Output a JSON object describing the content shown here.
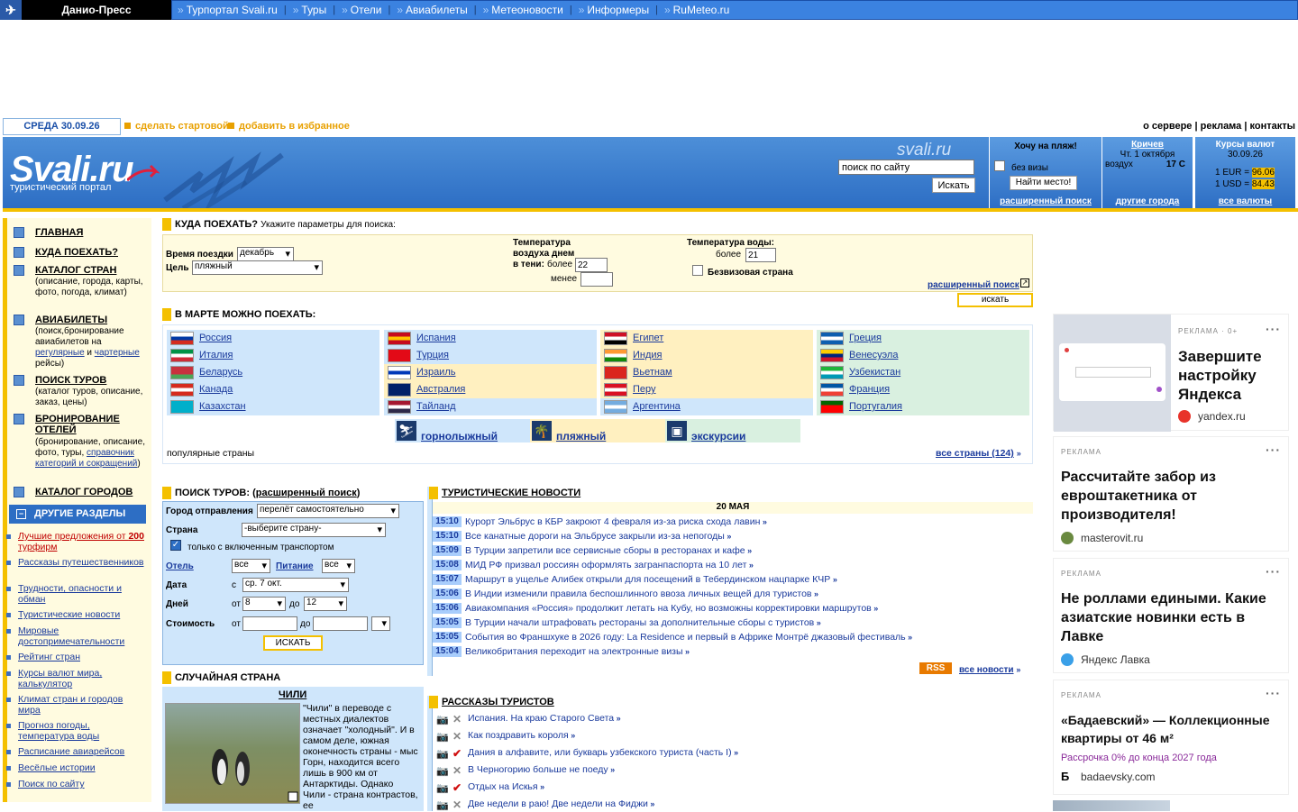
{
  "topbar": {
    "brand": "Данио-Пресс",
    "nav": [
      "Турпортал Svali.ru",
      "Туры",
      "Отели",
      "Авиабилеты",
      "Метеоновости",
      "Информеры",
      "RuMeteo.ru"
    ]
  },
  "daterow": {
    "date": "СРЕДА 30.09.26",
    "make_start": "сделать стартовой",
    "add_fav": "добавить в избранное",
    "right_links": "о сервере | реклама | контакты"
  },
  "header": {
    "logo": "Svali.ru",
    "subtitle": "туристический портал",
    "site": "svali.ru",
    "search_value": "поиск по сайту",
    "search_btn": "Искать"
  },
  "beach": {
    "title": "Хочу на пляж!",
    "no_visa": "без визы",
    "btn": "Найти место!",
    "bottom": "расширенный поиск"
  },
  "weather": {
    "city": "Кричев",
    "date": "Чт. 1 октября",
    "air_label": "воздух",
    "air_value": "17 С",
    "bottom": "другие города"
  },
  "currency": {
    "title": "Курсы валют",
    "date": "30.09.26",
    "eur_label": "1 EUR =",
    "eur": "96.06",
    "usd_label": "1 USD =",
    "usd": "84.43",
    "bottom": "все валюты"
  },
  "menu": {
    "items": [
      {
        "title": "ГЛАВНАЯ",
        "desc": ""
      },
      {
        "title": "КУДА ПОЕХАТЬ?",
        "desc": ""
      },
      {
        "title": "КАТАЛОГ СТРАН",
        "desc": "(описание, города, карты, фото, погода, климат)"
      },
      {
        "title": "АВИАБИЛЕТЫ",
        "desc1": "(поиск,бронирование авиабилетов на ",
        "link1": "регулярные",
        "mid": " и ",
        "link2": "чартерные",
        "desc2": " рейсы)"
      },
      {
        "title": "ПОИСК ТУРОВ",
        "desc": "(каталог туров, описание, заказ, цены)"
      },
      {
        "title": "БРОНИРОВАНИЕ ОТЕЛЕЙ",
        "desc1": "(бронирование, описание, фото, туры, ",
        "link1": "справочник категорий и сокращений",
        "desc2": ")"
      },
      {
        "title": "КАТАЛОГ ГОРОДОВ",
        "desc": ""
      }
    ],
    "other_title": "ДРУГИЕ РАЗДЕЛЫ",
    "other_first_a": "Лучшие предложения от ",
    "other_first_b": "200",
    "other_first_c": " турфирм",
    "other": [
      "Рассказы путешественников",
      "Трудности, опасности и обман",
      "Туристические новости",
      "Мировые достопримечательности",
      "Рейтинг стран",
      "Курсы валют мира, калькулятор",
      "Климат стран и городов мира",
      "Прогноз погоды, температура воды",
      "Расписание авиарейсов",
      "Весёлые истории",
      "Поиск по сайту"
    ]
  },
  "where": {
    "title": "КУДА ПОЕХАТЬ?",
    "hint": "Укажите параметры для поиска:",
    "time_label": "Время поездки",
    "time_value": "декабрь",
    "goal_label": "Цель",
    "goal_value": "пляжный",
    "temp_label": "Температура воздуха днем в тени:",
    "more": "более",
    "temp_more": "22",
    "less": "менее",
    "water_label": "Температура воды:",
    "water_more": "21",
    "visa_free": "Безвизовая страна",
    "adv": "расширенный поиск",
    "search": "искать"
  },
  "march": {
    "title": "В МАРТЕ МОЖНО ПОЕХАТЬ:",
    "cols": [
      [
        "Россия",
        "Италия",
        "Беларусь",
        "Канада",
        "Казахстан"
      ],
      [
        "Испания",
        "Турция",
        "Израиль",
        "Австралия",
        "Тайланд"
      ],
      [
        "Египет",
        "Индия",
        "Вьетнам",
        "Перу",
        "Аргентина"
      ],
      [
        "Греция",
        "Венесуэла",
        "Узбекистан",
        "Франция",
        "Португалия"
      ]
    ],
    "types": [
      "горнолыжный",
      "пляжный",
      "экскурсии"
    ],
    "popular": "популярные страны",
    "all": "все страны (124)"
  },
  "tours": {
    "title": "ПОИСК ТУРОВ:",
    "adv": "расширенный поиск",
    "city_label": "Город отправления",
    "city_value": "перелёт самостоятельно",
    "country_label": "Страна",
    "country_value": "-выберите страну-",
    "transport": "только с включенным транспортом",
    "hotel_label": "Отель",
    "hotel_value": "все",
    "food_label": "Питание",
    "food_value": "все",
    "date_label": "Дата",
    "date_from": "с",
    "date_value": "ср. 7 окт.",
    "days_label": "Дней",
    "days_from": "от",
    "days_from_v": "8",
    "days_to": "до",
    "days_to_v": "12",
    "cost_label": "Стоимость",
    "cost_from": "от",
    "cost_to": "до",
    "btn": "ИСКАТЬ"
  },
  "random": {
    "title": "СЛУЧАЙНАЯ СТРАНА",
    "country": "ЧИЛИ",
    "text": "\"Чили\" в переводе с местных диалектов означает \"холодный\". И в самом деле, южная оконечность страны - мыс Горн, находится всего лишь в 900 км от Антарктиды. Однако Чили - страна контрастов, ее"
  },
  "news": {
    "title": "ТУРИСТИЧЕСКИЕ НОВОСТИ",
    "date": "20 МАЯ",
    "items": [
      {
        "time": "15:10",
        "text": "Курорт Эльбрус в КБР закроют 4 февраля из-за риска схода лавин"
      },
      {
        "time": "15:10",
        "text": "Все канатные дороги на Эльбрусе закрыли из-за непогоды"
      },
      {
        "time": "15:09",
        "text": "В Турции запретили все сервисные сборы в ресторанах и кафе"
      },
      {
        "time": "15:08",
        "text": "МИД РФ призвал россиян оформлять загранпаспорта на 10 лет"
      },
      {
        "time": "15:07",
        "text": "Маршрут в ущелье Алибек открыли для посещений в Тебердинском нацпарке КЧР"
      },
      {
        "time": "15:06",
        "text": "В Индии изменили правила беспошлинного ввоза личных вещей для туристов"
      },
      {
        "time": "15:06",
        "text": "Авиакомпания «Россия» продолжит летать на Кубу, но возможны корректировки маршрутов"
      },
      {
        "time": "15:05",
        "text": "В Турции начали штрафовать рестораны за дополнительные сборы с туристов"
      },
      {
        "time": "15:05",
        "text": "События во Франшхуке в 2026 году: La Residence и первый в Африке Монтрё джазовый фестиваль"
      },
      {
        "time": "15:04",
        "text": "Великобритания переходит на электронные визы"
      }
    ],
    "rss": "RSS",
    "all": "все новости"
  },
  "stories": {
    "title": "РАССКАЗЫ ТУРИСТОВ",
    "items": [
      {
        "text": "Испания. На краю Старого Света",
        "mark": "x"
      },
      {
        "text": "Как поздравить короля",
        "mark": "x"
      },
      {
        "text": "Дания в алфавите, или букварь узбекского туриста (часть I)",
        "mark": "check"
      },
      {
        "text": "В Черногорию больше не поеду",
        "mark": "x"
      },
      {
        "text": "Отдых на Искья",
        "mark": "check"
      },
      {
        "text": "Две недели в раю! Две недели на Фиджи",
        "mark": "x"
      }
    ]
  },
  "ads": [
    {
      "label": "РЕКЛАМА · 0+",
      "title": "Завершите настройку Яндекса",
      "domain": "yandex.ru"
    },
    {
      "label": "РЕКЛАМА",
      "title": "Рассчитайте забор из евроштакетника от производителя!",
      "domain": "masterovit.ru"
    },
    {
      "label": "РЕКЛАМА",
      "title": "Не роллами едиными. Какие азиатские новинки есть в Лавке",
      "domain": "Яндекс Лавка"
    },
    {
      "label": "РЕКЛАМА",
      "title": "«Бадаевский» — Коллекционные квартиры от 46 м²",
      "sub": "Рассрочка 0% до конца 2027 года",
      "domain": "badaevsky.com"
    }
  ],
  "colors": {
    "accent": "#f4c000",
    "header_blue": "#2d6ec4",
    "link": "#1a3a9c"
  }
}
